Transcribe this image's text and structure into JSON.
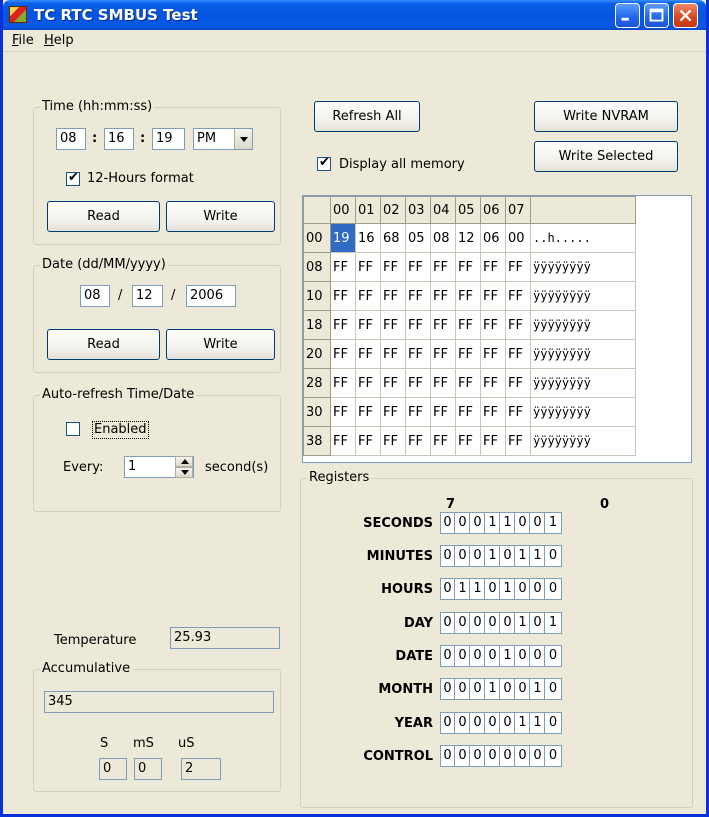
{
  "window": {
    "title": "TC RTC SMBUS Test"
  },
  "menu": [
    {
      "label": "File",
      "accel": "F",
      "rest": "ile"
    },
    {
      "label": "Help",
      "accel": "H",
      "rest": "elp"
    }
  ],
  "time": {
    "group_label": "Time (hh:mm:ss)",
    "hours": "08",
    "minutes": "16",
    "seconds": "19",
    "sep": ":",
    "ampm": "PM",
    "twelve_hour_label": "12-Hours format",
    "twelve_hour_checked": true,
    "read_label": "Read",
    "write_label": "Write"
  },
  "date": {
    "group_label": "Date (dd/MM/yyyy)",
    "day": "08",
    "month": "12",
    "year": "2006",
    "sep": "/",
    "read_label": "Read",
    "write_label": "Write"
  },
  "autorefresh": {
    "group_label": "Auto-refresh Time/Date",
    "enabled_label": "Enabled",
    "enabled_checked": false,
    "every_label": "Every:",
    "every_value": "1",
    "unit_label": "second(s)"
  },
  "temperature": {
    "label": "Temperature",
    "value": "25.93"
  },
  "accumulative": {
    "group_label": "Accumulative",
    "value": "345",
    "s_label": "S",
    "ms_label": "mS",
    "us_label": "uS",
    "s_value": "0",
    "ms_value": "0",
    "us_value": "2"
  },
  "toolbar": {
    "refresh_all": "Refresh All",
    "write_nvram": "Write NVRAM",
    "write_selected": "Write Selected",
    "display_all_memory": "Display all memory",
    "display_all_checked": true
  },
  "memory": {
    "columns": [
      "00",
      "01",
      "02",
      "03",
      "04",
      "05",
      "06",
      "07"
    ],
    "rows": [
      {
        "addr": "00",
        "cells": [
          "19",
          "16",
          "68",
          "05",
          "08",
          "12",
          "06",
          "00"
        ],
        "ascii": "..h....."
      },
      {
        "addr": "08",
        "cells": [
          "FF",
          "FF",
          "FF",
          "FF",
          "FF",
          "FF",
          "FF",
          "FF"
        ],
        "ascii": "ÿÿÿÿÿÿÿÿ"
      },
      {
        "addr": "10",
        "cells": [
          "FF",
          "FF",
          "FF",
          "FF",
          "FF",
          "FF",
          "FF",
          "FF"
        ],
        "ascii": "ÿÿÿÿÿÿÿÿ"
      },
      {
        "addr": "18",
        "cells": [
          "FF",
          "FF",
          "FF",
          "FF",
          "FF",
          "FF",
          "FF",
          "FF"
        ],
        "ascii": "ÿÿÿÿÿÿÿÿ"
      },
      {
        "addr": "20",
        "cells": [
          "FF",
          "FF",
          "FF",
          "FF",
          "FF",
          "FF",
          "FF",
          "FF"
        ],
        "ascii": "ÿÿÿÿÿÿÿÿ"
      },
      {
        "addr": "28",
        "cells": [
          "FF",
          "FF",
          "FF",
          "FF",
          "FF",
          "FF",
          "FF",
          "FF"
        ],
        "ascii": "ÿÿÿÿÿÿÿÿ"
      },
      {
        "addr": "30",
        "cells": [
          "FF",
          "FF",
          "FF",
          "FF",
          "FF",
          "FF",
          "FF",
          "FF"
        ],
        "ascii": "ÿÿÿÿÿÿÿÿ"
      },
      {
        "addr": "38",
        "cells": [
          "FF",
          "FF",
          "FF",
          "FF",
          "FF",
          "FF",
          "FF",
          "FF"
        ],
        "ascii": "ÿÿÿÿÿÿÿÿ"
      }
    ],
    "selected": {
      "row": 0,
      "col": 0
    }
  },
  "registers": {
    "group_label": "Registers",
    "msb_label": "7",
    "lsb_label": "0",
    "items": [
      {
        "name": "SECONDS",
        "bits": [
          "0",
          "0",
          "0",
          "1",
          "1",
          "0",
          "0",
          "1"
        ]
      },
      {
        "name": "MINUTES",
        "bits": [
          "0",
          "0",
          "0",
          "1",
          "0",
          "1",
          "1",
          "0"
        ]
      },
      {
        "name": "HOURS",
        "bits": [
          "0",
          "1",
          "1",
          "0",
          "1",
          "0",
          "0",
          "0"
        ]
      },
      {
        "name": "DAY",
        "bits": [
          "0",
          "0",
          "0",
          "0",
          "0",
          "1",
          "0",
          "1"
        ]
      },
      {
        "name": "DATE",
        "bits": [
          "0",
          "0",
          "0",
          "0",
          "1",
          "0",
          "0",
          "0"
        ]
      },
      {
        "name": "MONTH",
        "bits": [
          "0",
          "0",
          "0",
          "1",
          "0",
          "0",
          "1",
          "0"
        ]
      },
      {
        "name": "YEAR",
        "bits": [
          "0",
          "0",
          "0",
          "0",
          "0",
          "1",
          "1",
          "0"
        ]
      },
      {
        "name": "CONTROL",
        "bits": [
          "0",
          "0",
          "0",
          "0",
          "0",
          "0",
          "0",
          "0"
        ]
      }
    ]
  }
}
